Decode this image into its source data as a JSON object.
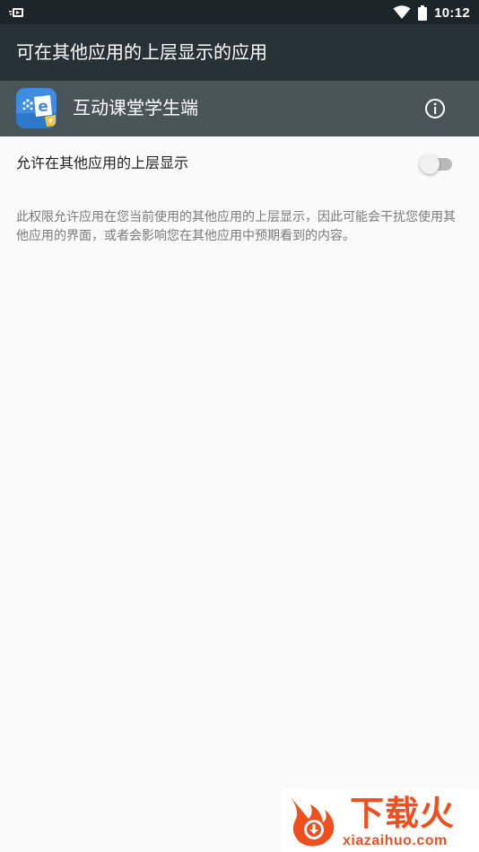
{
  "status_bar": {
    "time": "10:12",
    "left_icon": "notification-icon",
    "wifi_icon": "wifi-icon",
    "battery_icon": "battery-icon"
  },
  "app_bar": {
    "title": "可在其他应用的上层显示的应用"
  },
  "app_header": {
    "app_name": "互动课堂学生端",
    "info_icon": "info-icon"
  },
  "setting": {
    "label": "允许在其他应用的上层显示",
    "enabled": false
  },
  "description": "此权限允许应用在您当前使用的其他应用的上层显示，因此可能会干扰您使用其他应用的界面，或者会影响您在其他应用中预期看到的内容。",
  "watermark": {
    "text": "下载火",
    "url": "xiazaihuo.com"
  },
  "colors": {
    "status_bar": "#1c2529",
    "app_bar": "#263238",
    "app_header": "#4a5559",
    "background": "#fafafa",
    "watermark": "#ef4f1f"
  }
}
